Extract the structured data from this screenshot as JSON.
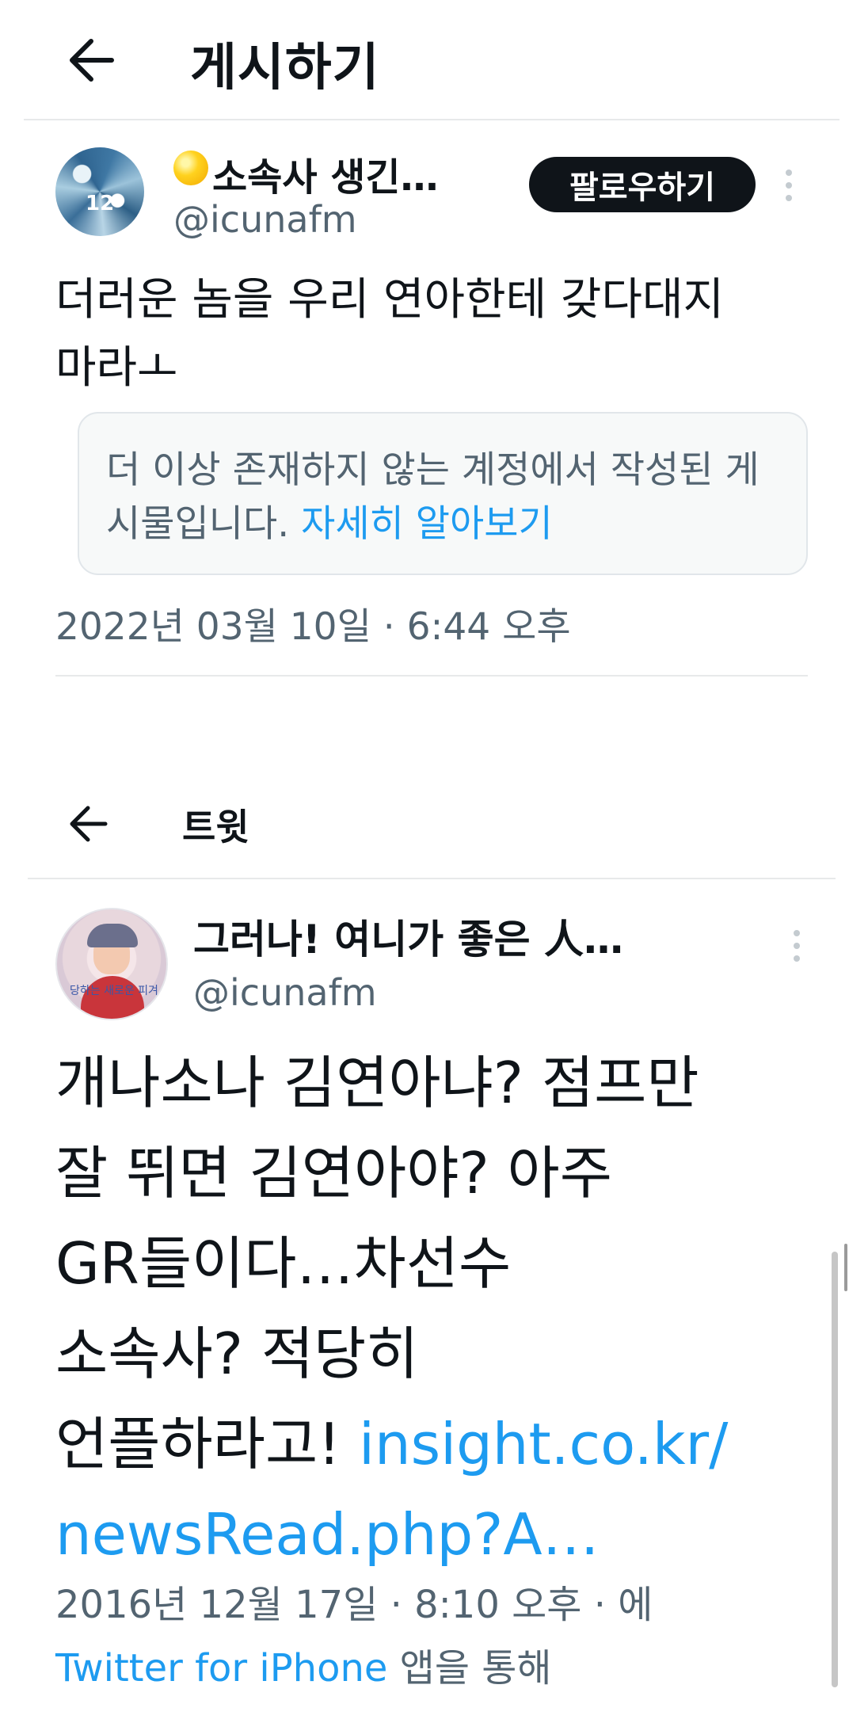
{
  "post1": {
    "header_title": "게시하기",
    "author_name": "소속사 생긴…",
    "author_handle": "@icunafm",
    "follow_label": "팔로우하기",
    "body_lines": [
      "더러운 놈을 우리 연아한테 갖다대지",
      "마라ㅗ"
    ],
    "notice_text": "더 이상 존재하지 않는 계정에서 작성된 게시물입니다. ",
    "notice_link": "자세히 알아보기",
    "timestamp": "2022년 03월 10일 · 6:44 오후"
  },
  "post2": {
    "header_title": "트윗",
    "author_name": "그러나! 여니가 좋은 人…",
    "author_handle": "@icunafm",
    "body_lines": [
      "개나소나 김연아냐? 점프만",
      "잘 뛰면 김연아야? 아주",
      "GR들이다…차선수",
      "소속사? 적당히"
    ],
    "body_last_prefix": "언플하라고! ",
    "body_link_1": "insight.co.kr/",
    "body_link_2": "newsRead.php?A…",
    "timestamp": "2016년 12월 17일 · 8:10 오후 · 에",
    "source_link": "Twitter for iPhone",
    "source_suffix": " 앱을 통해",
    "avatar_caption": "당하는 새로운 피겨"
  },
  "colors": {
    "link": "#1d9bf0",
    "secondary_text": "#536471",
    "divider": "#e7e9ea",
    "follow_bg": "#0f1419"
  },
  "icons": [
    "back-arrow-icon",
    "more-options-icon",
    "sun-emoji-icon"
  ]
}
